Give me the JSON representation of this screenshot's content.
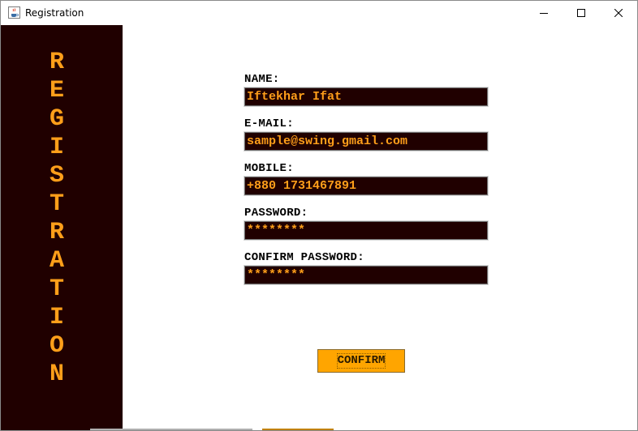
{
  "window": {
    "title": "Registration",
    "icon": "java-cup-icon"
  },
  "side_panel": {
    "letters": [
      "R",
      "E",
      "G",
      "I",
      "S",
      "T",
      "R",
      "A",
      "T",
      "I",
      "O",
      "N"
    ],
    "background": "#200000",
    "text_color": "#ff9f1a"
  },
  "form": {
    "fields": [
      {
        "label": "NAME:",
        "value": "Iftekhar Ifat"
      },
      {
        "label": "E-MAIL:",
        "value": "sample@swing.gmail.com"
      },
      {
        "label": "MOBILE:",
        "value": "+880 1731467891"
      },
      {
        "label": "PASSWORD:",
        "value": "********"
      },
      {
        "label": "CONFIRM PASSWORD:",
        "value": "********"
      }
    ],
    "confirm_label": "CONFIRM"
  },
  "colors": {
    "button_bg": "#ffa500",
    "input_bg": "#200000",
    "input_text": "#ff9f1a"
  }
}
